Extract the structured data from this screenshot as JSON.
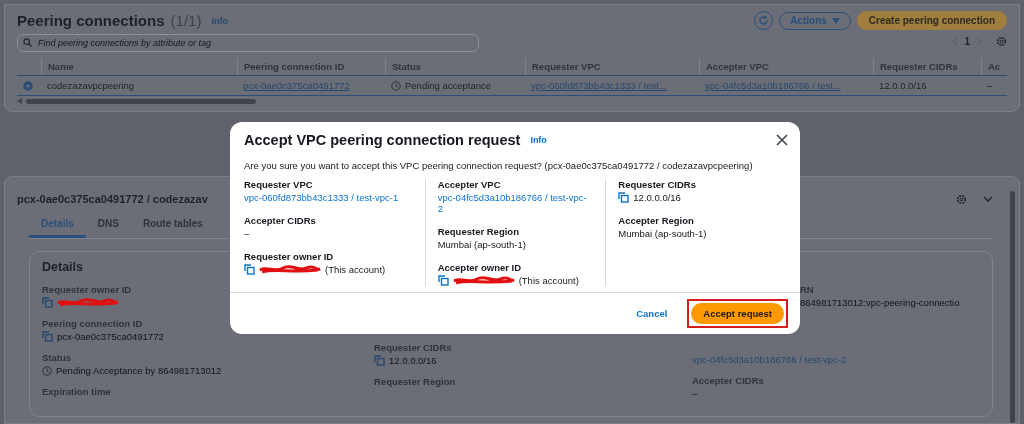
{
  "list_panel": {
    "title": "Peering connections",
    "count": "(1/1)",
    "info": "Info",
    "actions": "Actions",
    "create_button": "Create peering connection",
    "search": {
      "placeholder": "Find peering connections by attribute or tag"
    },
    "page": "1",
    "columns": [
      "Name",
      "Peering connection ID",
      "Status",
      "Requester VPC",
      "Accepter VPC",
      "Requester CIDRs",
      "Ac"
    ],
    "rows": [
      {
        "selected": true,
        "name": "codezazavpcpeering",
        "id": "pcx-0ae0c375ca0491772",
        "status": "Pending acceptance",
        "requester_vpc": "vpc-060fd873bb43c1333 / test...",
        "accepter_vpc": "vpc-04fc5d3a10b186766 / test...",
        "requester_cidrs": "12.0.0.0/16",
        "column_8": "–"
      }
    ]
  },
  "detail_panel": {
    "title": "pcx-0ae0c375ca0491772 / codezazav",
    "tabs": [
      {
        "label": "Details",
        "selected": true
      },
      {
        "label": "DNS",
        "selected": false
      },
      {
        "label": "Route tables",
        "selected": false
      }
    ],
    "card_title": "Details",
    "columns": [
      [
        {
          "label": "Requester owner ID",
          "kind": "redacted"
        },
        {
          "label": "Peering connection ID",
          "value": "pcx-0ae0c375ca0491772",
          "kind": "copy"
        },
        {
          "label": "Status",
          "value": "Pending Acceptance by 864981713012",
          "kind": "status"
        },
        {
          "label": "Expiration time",
          "kind": "plain"
        }
      ],
      [
        {
          "label": "Requester CIDRs",
          "value": "12.0.0.0/16",
          "kind": "copy"
        },
        {
          "label": "Requester Region",
          "kind": "plain"
        }
      ],
      [
        {
          "label": "RN",
          "value": "864981713012:vpc-peering-connectio",
          "kind": "plain"
        },
        {
          "value": "vpc-04fc5d3a10b186766 / test-vpc-2",
          "kind": "link"
        },
        {
          "label": "Accepter CIDRs",
          "value": "–",
          "kind": "plain"
        }
      ]
    ]
  },
  "dialog": {
    "title": "Accept VPC peering connection request",
    "info": "Info",
    "message": "Are you sure you want to accept this VPC peering connection request? (pcx-0ae0c375ca0491772 / codezazavpcpeering)",
    "columns": [
      [
        {
          "label": "Requester VPC",
          "value": "vpc-060fd873bb43c1333 / test-vpc-1",
          "kind": "link"
        },
        {
          "label": "Accepter CIDRs",
          "value": "–",
          "kind": "plain"
        },
        {
          "label": "Requester owner ID",
          "value": "(This account)",
          "kind": "redacted"
        }
      ],
      [
        {
          "label": "Accepter VPC",
          "value": "vpc-04fc5d3a10b186766 / test-vpc-2",
          "kind": "link"
        },
        {
          "label": "Requester Region",
          "value": "Mumbai (ap-south-1)",
          "kind": "plain"
        },
        {
          "label": "Accepter owner ID",
          "value": "(This account)",
          "kind": "redacted"
        }
      ],
      [
        {
          "label": "Requester CIDRs",
          "value": "12.0.0.0/16",
          "kind": "copy"
        },
        {
          "label": "Accepter Region",
          "value": "Mumbai (ap-south-1)",
          "kind": "plain"
        }
      ]
    ],
    "cancel": "Cancel",
    "accept": "Accept request",
    "accept_highlighted": true
  }
}
